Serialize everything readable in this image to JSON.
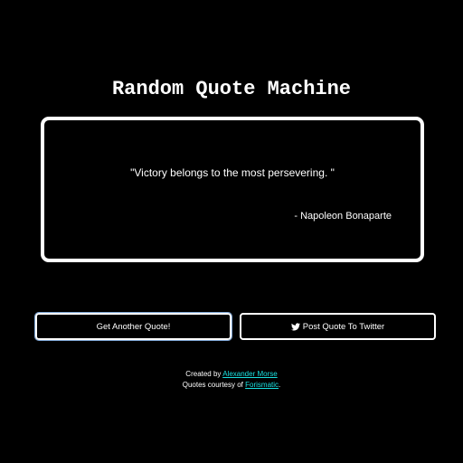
{
  "page": {
    "title": "Random Quote Machine"
  },
  "quote": {
    "text": "\"Victory belongs to the most persevering. \"",
    "author": "- Napoleon Bonaparte"
  },
  "buttons": {
    "new_quote_label": "Get Another Quote!",
    "tweet_label": "Post Quote To Twitter",
    "tweet_icon": "twitter-bird-icon"
  },
  "footer": {
    "created_prefix": "Created by ",
    "creator_link": "Alexander Morse",
    "quotes_prefix": "Quotes courtesy of ",
    "source_link": "Forismatic",
    "quotes_suffix": "."
  },
  "colors": {
    "background": "#000000",
    "foreground": "#ffffff",
    "link": "#19e0e0",
    "focus_ring": "#7fa7d6"
  }
}
